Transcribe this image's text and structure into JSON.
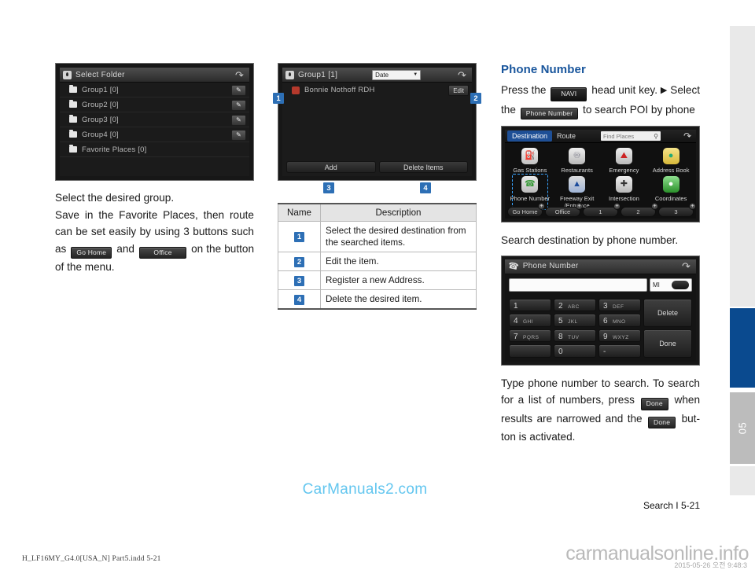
{
  "page": {
    "footer_ref": "Search I 5-21",
    "print_code": "H_LF16MY_G4.0[USA_N] Part5.indd   5-21",
    "watermark_center": "CarManuals2.com",
    "watermark_corner": "carmanualsonline.info",
    "watermark_stamp": "2015-05-26   오전 9:48:3",
    "tab_number": "05",
    "accent_blue": "#0a4a8f",
    "badge_blue": "#2d6fb5",
    "heading_blue": "#18559c"
  },
  "left_column": {
    "screenshot": {
      "title": "Select Folder",
      "back_icon": "back-arrow-icon",
      "rows": [
        {
          "label": "Group1 [0]",
          "has_edit": true
        },
        {
          "label": "Group2 [0]",
          "has_edit": true
        },
        {
          "label": "Group3 [0]",
          "has_edit": true
        },
        {
          "label": "Group4 [0]",
          "has_edit": true
        },
        {
          "label": "Favorite Places [0]",
          "has_edit": false
        }
      ]
    },
    "para1": "Select the desired group.",
    "para2_a": "Save in the Favorite Places, then route can be set easily by using 3 buttons such as",
    "chip_go_home": "Go Home",
    "para2_b": "and",
    "chip_office": "Office",
    "para2_c": "on the button of the menu."
  },
  "mid_column": {
    "screenshot": {
      "title": "Group1 [1]",
      "sort_value": "Date",
      "item_label": "Bonnie Nothoff RDH",
      "edit_label": "Edit",
      "add_label": "Add",
      "delete_label": "Delete Items",
      "callouts": [
        "1",
        "2",
        "3",
        "4"
      ]
    },
    "table": {
      "headers": [
        "Name",
        "Description"
      ],
      "rows": [
        {
          "name": "1",
          "description": "Select the desired destination from the searched items."
        },
        {
          "name": "2",
          "description": "Edit the item."
        },
        {
          "name": "3",
          "description": "Register a new Address."
        },
        {
          "name": "4",
          "description": "Delete the desired item."
        }
      ]
    }
  },
  "right_column": {
    "heading": "Phone Number",
    "para1_a": "Press the",
    "chip_navi": "NAVI",
    "para1_b": "head unit key.",
    "arrow": "▶",
    "para1_c": "Select the",
    "chip_phone_number": "Phone Number",
    "para1_d": "to search POI by phone",
    "dest_screen": {
      "tabs": [
        "Destination",
        "Route"
      ],
      "search_placeholder": "Find Places",
      "search_icon": "magnifier-icon",
      "back_icon": "back-arrow-icon",
      "items": [
        {
          "label": "Gas Stations",
          "icon": "gas-pump-icon",
          "glyph": "⛽",
          "selected": false
        },
        {
          "label": "Restaurants",
          "icon": "cutlery-icon",
          "glyph": "🍴",
          "selected": false
        },
        {
          "label": "Emergency",
          "icon": "ambulance-icon",
          "glyph": "🚑",
          "selected": false
        },
        {
          "label": "Address Book",
          "icon": "address-book-icon",
          "glyph": "📕",
          "selected": false
        },
        {
          "label": "Phone Number",
          "icon": "phone-handset-icon",
          "glyph": "☎",
          "selected": true
        },
        {
          "label": "Freeway Exit /Entrance",
          "icon": "freeway-shield-icon",
          "glyph": "🛣",
          "selected": false
        },
        {
          "label": "Intersection",
          "icon": "intersection-icon",
          "glyph": "✚",
          "selected": false
        },
        {
          "label": "Coordinates",
          "icon": "globe-icon",
          "glyph": "🌐",
          "selected": false
        }
      ],
      "bottom_buttons": [
        "Go Home",
        "Office",
        "1",
        "2",
        "3"
      ]
    },
    "para2": "Search destination by phone number.",
    "keypad_screen": {
      "title": "Phone Number",
      "title_icon": "phone-handset-icon",
      "back_icon": "back-arrow-icon",
      "input_value": "",
      "mi_label": "MI",
      "keys": [
        {
          "num": "1",
          "letters": ""
        },
        {
          "num": "2",
          "letters": "ABC"
        },
        {
          "num": "3",
          "letters": "DEF"
        },
        {
          "num": "4",
          "letters": "GHI"
        },
        {
          "num": "5",
          "letters": "JKL"
        },
        {
          "num": "6",
          "letters": "MNO"
        },
        {
          "num": "7",
          "letters": "PQRS"
        },
        {
          "num": "8",
          "letters": "TUV"
        },
        {
          "num": "9",
          "letters": "WXYZ"
        },
        {
          "num": "",
          "letters": ""
        },
        {
          "num": "0",
          "letters": ""
        },
        {
          "num": "-",
          "letters": ""
        }
      ],
      "delete_label": "Delete",
      "done_label": "Done"
    },
    "para3_a": "Type phone number to search. To search for a list of numbers, press",
    "chip_done_1": "Done",
    "para3_b": "when results are narrowed and the",
    "chip_done_2": "Done",
    "para3_c": "but-ton is activated."
  }
}
